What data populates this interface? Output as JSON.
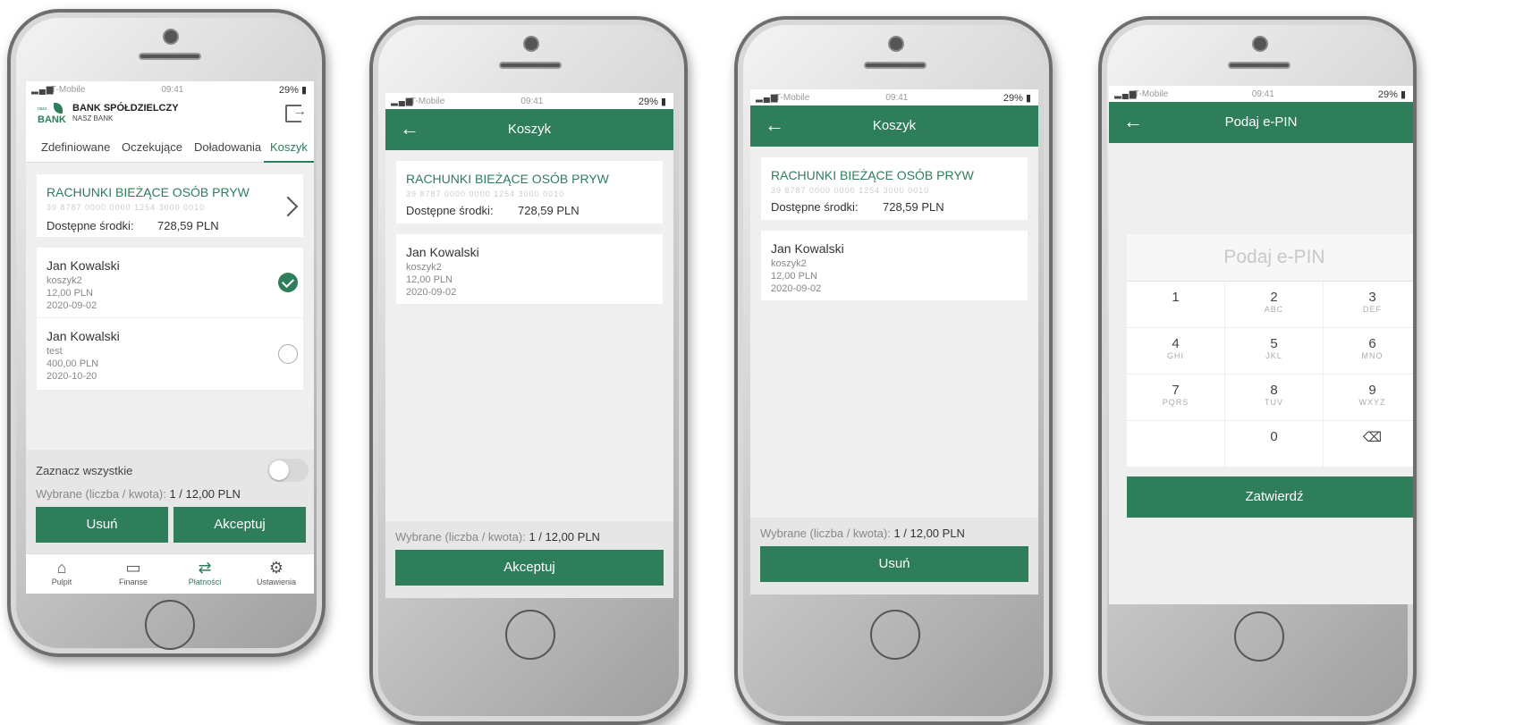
{
  "status": {
    "carrier": "T-Mobile",
    "time": "09:41",
    "battery": "29%"
  },
  "bank": {
    "name": "BANK SPÓŁDZIELCZY",
    "sub": "NASZ BANK",
    "logo_word": "BANK",
    "logo_small": "nasz"
  },
  "tabs": [
    "Zdefiniowane",
    "Oczekujące",
    "Doładowania",
    "Koszyk"
  ],
  "account": {
    "name": "RACHUNKI BIEŻĄCE OSÓB PRYW",
    "number": "39 8787 0000 0000 1254 3000 0010",
    "balance_label": "Dostępne środki:",
    "balance_value": "728,59 PLN"
  },
  "items": [
    {
      "name": "Jan Kowalski",
      "desc": "koszyk2",
      "amount": "12,00 PLN",
      "date": "2020-09-02",
      "selected": true
    },
    {
      "name": "Jan Kowalski",
      "desc": "test",
      "amount": "400,00 PLN",
      "date": "2020-10-20",
      "selected": false
    }
  ],
  "footer": {
    "select_all": "Zaznacz wszystkie",
    "summary_label": "Wybrane (liczba / kwota): ",
    "summary_value": "1 / 12,00 PLN",
    "delete": "Usuń",
    "accept": "Akceptuj"
  },
  "nav": [
    {
      "label": "Pulpit",
      "icon": "home-icon"
    },
    {
      "label": "Finanse",
      "icon": "wallet-icon"
    },
    {
      "label": "Płatności",
      "icon": "transfer-icon"
    },
    {
      "label": "Ustawienia",
      "icon": "gear-icon"
    }
  ],
  "basket": {
    "title": "Koszyk",
    "back": "←"
  },
  "pin": {
    "title": "Podaj e-PIN",
    "placeholder": "Podaj e-PIN",
    "keys": [
      {
        "d": "1",
        "l": ""
      },
      {
        "d": "2",
        "l": "ABC"
      },
      {
        "d": "3",
        "l": "DEF"
      },
      {
        "d": "4",
        "l": "GHI"
      },
      {
        "d": "5",
        "l": "JKL"
      },
      {
        "d": "6",
        "l": "MNO"
      },
      {
        "d": "7",
        "l": "PQRS"
      },
      {
        "d": "8",
        "l": "TUV"
      },
      {
        "d": "9",
        "l": "WXYZ"
      },
      {
        "d": "",
        "l": ""
      },
      {
        "d": "0",
        "l": ""
      },
      {
        "d": "⌫",
        "l": ""
      }
    ],
    "confirm": "Zatwierdź"
  },
  "colors": {
    "brand_green": "#2e7d5b",
    "screen_bg": "#efefef"
  }
}
